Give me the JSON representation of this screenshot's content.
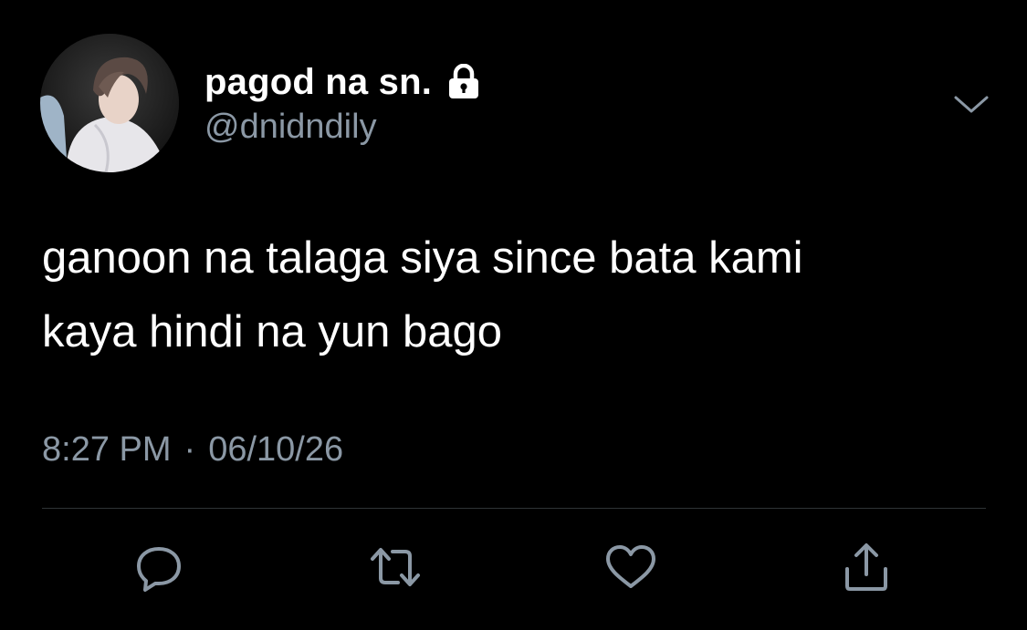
{
  "tweet": {
    "author": {
      "display_name": "pagod na sn.",
      "handle": "@dnidndily",
      "protected_icon": "lock-icon",
      "avatar": "profile-photo"
    },
    "text_lines": [
      "ganoon na talaga siya since bata kami",
      "kaya hindi na yun bago"
    ],
    "time": "8:27 PM",
    "separator": "·",
    "date": "06/10/26",
    "menu_icon": "chevron-down-icon",
    "actions": [
      {
        "name": "reply",
        "icon": "reply-icon"
      },
      {
        "name": "retweet",
        "icon": "retweet-icon"
      },
      {
        "name": "like",
        "icon": "heart-icon"
      },
      {
        "name": "share",
        "icon": "share-icon"
      }
    ]
  },
  "colors": {
    "background": "#000000",
    "primary_text": "#ffffff",
    "secondary_text": "#8b98a5",
    "divider": "#2f3336",
    "icon": "#8b98a5"
  }
}
